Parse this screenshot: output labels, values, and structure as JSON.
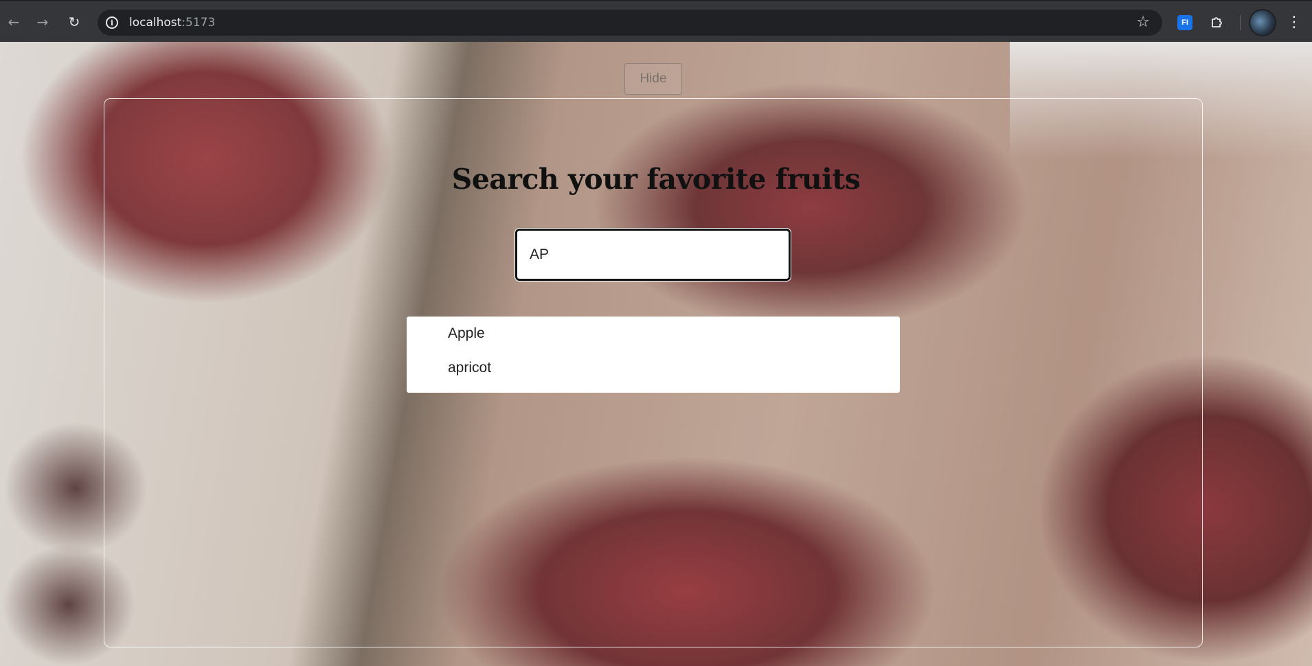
{
  "browser": {
    "url_host": "localhost",
    "url_port": ":5173",
    "icons": {
      "back": "back-arrow-icon",
      "forward": "forward-arrow-icon",
      "reload": "reload-icon",
      "site_info": "info-icon",
      "bookmark": "star-icon",
      "extension": "puzzle-icon",
      "menu": "kebab-menu-icon"
    },
    "extension_badge": "FI"
  },
  "page": {
    "hide_button_label": "Hide",
    "title": "Search your favorite fruits",
    "search": {
      "value": "AP",
      "placeholder": ""
    },
    "suggestions": [
      {
        "label": "Apple"
      },
      {
        "label": "apricot"
      }
    ]
  },
  "colors": {
    "chrome_bg": "#35363a",
    "omnibox_bg": "#202124",
    "title_text": "#111111",
    "input_border": "#111111"
  }
}
